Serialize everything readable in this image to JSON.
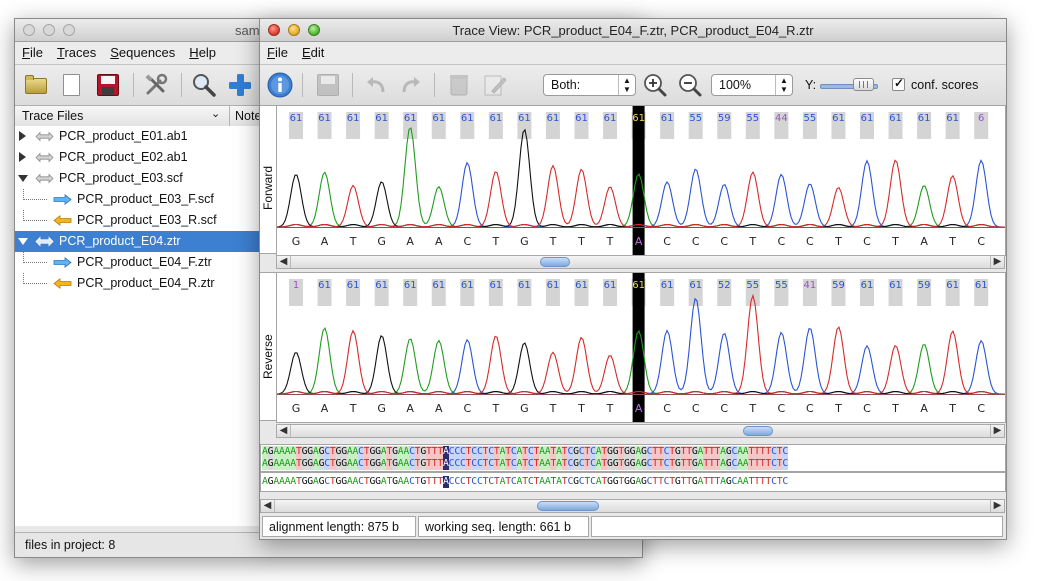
{
  "main_window": {
    "title": "sam",
    "menu": [
      "File",
      "Traces",
      "Sequences",
      "Help"
    ],
    "tree": {
      "header_left": "Trace Files",
      "header_right": "Note",
      "items": [
        {
          "label": "PCR_product_E01.ab1",
          "level": 0,
          "expander": "collapsed",
          "icon": "pair-arrows-icon"
        },
        {
          "label": "PCR_product_E02.ab1",
          "level": 0,
          "expander": "collapsed",
          "icon": "pair-arrows-icon"
        },
        {
          "label": "PCR_product_E03.scf",
          "level": 0,
          "expander": "expanded",
          "icon": "pair-arrows-icon"
        },
        {
          "label": "PCR_product_E03_F.scf",
          "level": 1,
          "icon": "forward-arrow-icon"
        },
        {
          "label": "PCR_product_E03_R.scf",
          "level": 1,
          "icon": "reverse-arrow-icon"
        },
        {
          "label": "PCR_product_E04.ztr",
          "level": 0,
          "expander": "expanded",
          "icon": "pair-arrows-icon",
          "selected": true
        },
        {
          "label": "PCR_product_E04_F.ztr",
          "level": 1,
          "icon": "forward-arrow-icon"
        },
        {
          "label": "PCR_product_E04_R.ztr",
          "level": 1,
          "icon": "reverse-arrow-icon"
        }
      ]
    },
    "status": "files in project: 8"
  },
  "trace_window": {
    "title": "Trace View: PCR_product_E04_F.ztr, PCR_product_E04_R.ztr",
    "menu": [
      "File",
      "Edit"
    ],
    "toolbar": {
      "strand_select": "Both:",
      "zoom_select": "100%",
      "y_label": "Y:",
      "conf_checkbox_label": "conf. scores",
      "conf_checked": true
    },
    "forward": {
      "label": "Forward",
      "quality": [
        "61",
        "61",
        "61",
        "61",
        "61",
        "61",
        "61",
        "61",
        "61",
        "61",
        "61",
        "61",
        "61",
        "61",
        "55",
        "59",
        "55",
        "44",
        "55",
        "61",
        "61",
        "61",
        "61",
        "61",
        "6"
      ],
      "bases": [
        "G",
        "A",
        "T",
        "G",
        "A",
        "A",
        "C",
        "T",
        "G",
        "T",
        "T",
        "T",
        "A",
        "C",
        "C",
        "C",
        "T",
        "C",
        "C",
        "T",
        "C",
        "T",
        "A",
        "T",
        "C"
      ]
    },
    "reverse": {
      "label": "Reverse",
      "quality": [
        "1",
        "61",
        "61",
        "61",
        "61",
        "61",
        "61",
        "61",
        "61",
        "61",
        "61",
        "61",
        "61",
        "61",
        "61",
        "52",
        "55",
        "55",
        "41",
        "59",
        "61",
        "61",
        "59",
        "61",
        "61"
      ],
      "bases": [
        "G",
        "A",
        "T",
        "G",
        "A",
        "A",
        "C",
        "T",
        "G",
        "T",
        "T",
        "T",
        "A",
        "C",
        "C",
        "C",
        "T",
        "C",
        "C",
        "T",
        "C",
        "T",
        "A",
        "T",
        "C"
      ]
    },
    "alignment": {
      "forward_seq": "AGAAAATGGAGCTGGAACTGGATGAACTGTTTACCCTCCTCTATCATCTAATATCGCTCATGGTGGAGCTTCTGTTGATTTAGCAATTTTCTC",
      "reverse_seq": "AGAAAATGGAGCTGGAACTGGATGAACTGTTTACCCTCCTCTATCATCTAATATCGCTCATGGTGGAGCTTCTGTTGATTTAGCAATTTTCTC",
      "consensus_seq": "AGAAAATGGAGCTGGAACTGGATGAACTGTTTACCCTCCTCTATCATCTAATATCGCTCATGGTGGAGCTTCTGTTGATTTAGCAATTTTCTC"
    },
    "status": {
      "alignment_length": "alignment length: 875 b",
      "working_length": "working seq. length: 661 b"
    }
  },
  "colors": {
    "A": "#1f9d1f",
    "C": "#2a54d6",
    "G": "#111111",
    "T": "#d62a2a",
    "cursor": "#000000",
    "selection": "#3d7fd1",
    "quality_bar": "#d4d4d4",
    "quality_text": "#2a54d6",
    "quality_low_text": "#9a52c8"
  }
}
